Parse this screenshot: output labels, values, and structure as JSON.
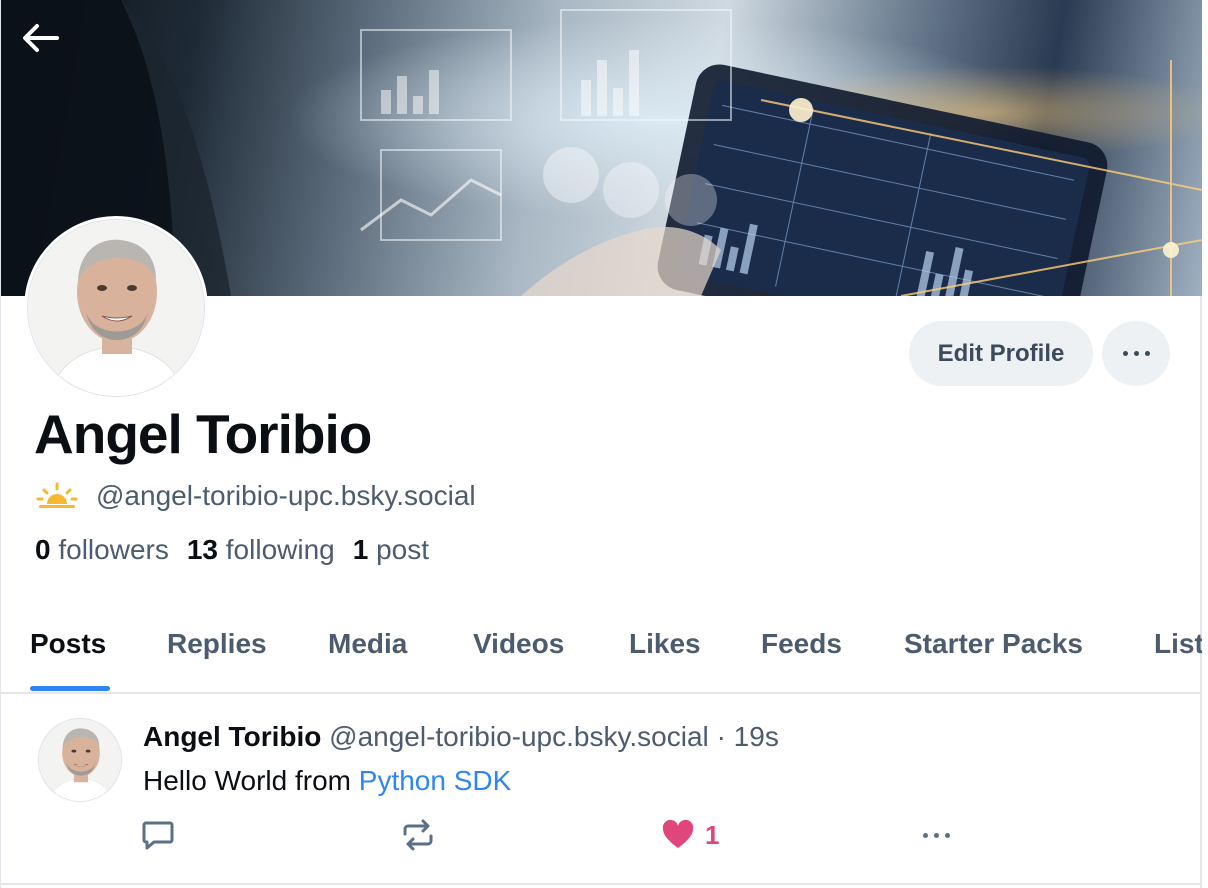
{
  "profile": {
    "display_name": "Angel Toribio",
    "handle": "@angel-toribio-upc.bsky.social",
    "edit_button": "Edit Profile",
    "stats": {
      "followers_count": "0",
      "followers_label": "followers",
      "following_count": "13",
      "following_label": "following",
      "posts_count": "1",
      "posts_label": "post"
    }
  },
  "tabs": [
    {
      "label": "Posts",
      "active": true
    },
    {
      "label": "Replies"
    },
    {
      "label": "Media"
    },
    {
      "label": "Videos"
    },
    {
      "label": "Likes"
    },
    {
      "label": "Feeds"
    },
    {
      "label": "Starter Packs"
    },
    {
      "label": "Lists"
    }
  ],
  "post": {
    "author": "Angel Toribio",
    "handle": "@angel-toribio-upc.bsky.social",
    "separator": "·",
    "time": "19s",
    "text_prefix": "Hello World from ",
    "text_link": "Python SDK",
    "like_count": "1"
  },
  "icons": {
    "back": "arrow-left-icon",
    "more": "ellipsis-icon",
    "status": "sunrise-icon",
    "reply": "comment-icon",
    "repost": "repost-icon",
    "like": "heart-icon"
  },
  "colors": {
    "accent": "#2f86f2",
    "like": "#e0457b",
    "muted_text": "#4c5c6e",
    "button_bg": "#eef1f4"
  }
}
